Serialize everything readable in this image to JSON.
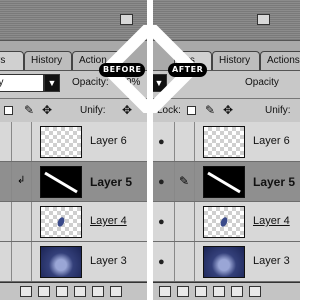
{
  "before": {
    "badge": "BEFORE",
    "tabs": [
      "rs",
      "History",
      "Action"
    ],
    "blend_mode": "ay",
    "opacity_label": "Opacity:",
    "opacity_value": "0%",
    "unify_label": "Unify:",
    "layers": [
      {
        "name": "Layer 6",
        "thumb": "transparent"
      },
      {
        "name": "Layer 5",
        "thumb": "black-brush"
      },
      {
        "name": "Layer 4",
        "thumb": "transparent-drop"
      },
      {
        "name": "Layer 3",
        "thumb": "blue-photo"
      }
    ]
  },
  "after": {
    "badge": "AFTER",
    "tabs": [
      "ers",
      "History",
      "Actions"
    ],
    "blend_mode": "",
    "opacity_label": "Opacity",
    "lock_label": "Lock:",
    "unify_label": "Unify:",
    "layers": [
      {
        "name": "Layer 6",
        "thumb": "transparent"
      },
      {
        "name": "Layer 5",
        "thumb": "black-brush"
      },
      {
        "name": "Layer 4",
        "thumb": "transparent-drop"
      },
      {
        "name": "Layer 3",
        "thumb": "blue-photo"
      }
    ]
  },
  "selected_layer": "Layer 5",
  "colors": {
    "panel": "#c8c8c8",
    "selected_row": "#8f8f8f",
    "badge": "#000000"
  }
}
